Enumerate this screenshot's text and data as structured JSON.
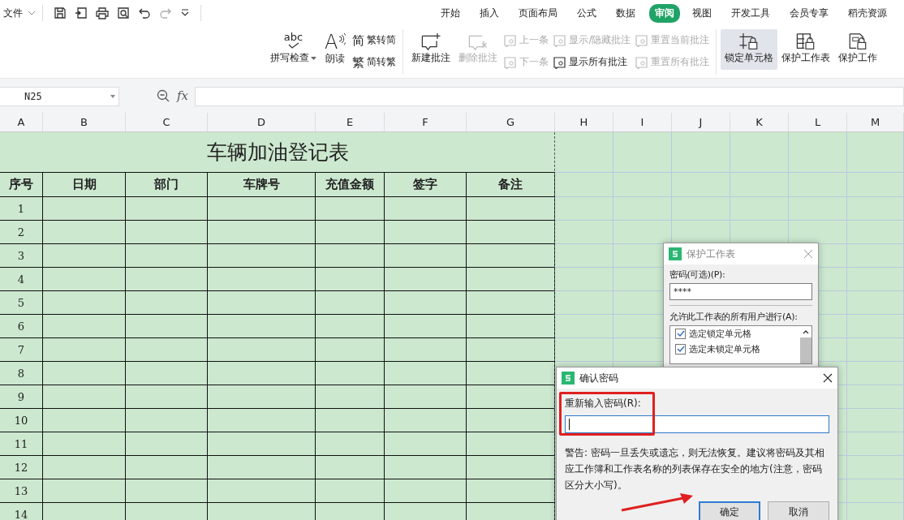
{
  "toolbar": {
    "file_menu": "文件"
  },
  "tabs": [
    {
      "label": "开始",
      "selected": false
    },
    {
      "label": "插入",
      "selected": false
    },
    {
      "label": "页面布局",
      "selected": false
    },
    {
      "label": "公式",
      "selected": false
    },
    {
      "label": "数据",
      "selected": false
    },
    {
      "label": "审阅",
      "selected": true
    },
    {
      "label": "视图",
      "selected": false
    },
    {
      "label": "开发工具",
      "selected": false
    },
    {
      "label": "会员专享",
      "selected": false
    },
    {
      "label": "稻壳资源",
      "selected": false
    }
  ],
  "ribbon": {
    "groups": [
      {
        "columns": [
          {
            "kind": "large",
            "items": [
              {
                "label": "拼写检查",
                "icon_text": "abc",
                "dropdown": true,
                "disabled": false,
                "selected": false
              }
            ]
          },
          {
            "kind": "large",
            "items": [
              {
                "label": "朗读",
                "icon_text": "A",
                "disabled": false,
                "selected": false
              }
            ]
          },
          {
            "kind": "small",
            "items": [
              {
                "label": "繁转简",
                "icon_text": "简",
                "disabled": false
              },
              {
                "label": "简转繁",
                "icon_text": "繁",
                "disabled": false
              }
            ]
          }
        ]
      },
      {
        "columns": [
          {
            "kind": "large",
            "items": [
              {
                "label": "新建批注",
                "disabled": false,
                "selected": false
              }
            ]
          },
          {
            "kind": "large",
            "items": [
              {
                "label": "删除批注",
                "disabled": true,
                "selected": false
              }
            ]
          },
          {
            "kind": "small",
            "items": [
              {
                "label": "上一条",
                "disabled": true
              },
              {
                "label": "下一条",
                "disabled": true
              }
            ]
          },
          {
            "kind": "small",
            "items": [
              {
                "label": "显示/隐藏批注",
                "disabled": true
              },
              {
                "label": "显示所有批注",
                "disabled": false
              }
            ]
          },
          {
            "kind": "small",
            "items": [
              {
                "label": "重置当前批注",
                "disabled": true
              },
              {
                "label": "重置所有批注",
                "disabled": true
              }
            ]
          }
        ]
      },
      {
        "columns": [
          {
            "kind": "large",
            "items": [
              {
                "label": "锁定单元格",
                "disabled": false,
                "selected": true
              }
            ]
          },
          {
            "kind": "large",
            "items": [
              {
                "label": "保护工作表",
                "disabled": false,
                "selected": false
              }
            ]
          },
          {
            "kind": "large",
            "items": [
              {
                "label": "保护工作",
                "disabled": false,
                "selected": false
              }
            ]
          }
        ]
      }
    ]
  },
  "formula_bar": {
    "name_box": "N25",
    "fx": "fx"
  },
  "sheet": {
    "columns": [
      "A",
      "B",
      "C",
      "D",
      "E",
      "F",
      "G",
      "H",
      "I",
      "J",
      "K",
      "L",
      "M"
    ],
    "title": "车辆加油登记表",
    "headers": [
      "序号",
      "日期",
      "部门",
      "车牌号",
      "充值金额",
      "签字",
      "备注"
    ],
    "rows": [
      "1",
      "2",
      "3",
      "4",
      "5",
      "6",
      "7",
      "8",
      "9",
      "10",
      "11",
      "12",
      "13",
      "14"
    ]
  },
  "protect_dialog": {
    "title": "保护工作表",
    "password_label": "密码(可选)(P):",
    "password": "****",
    "allow_label": "允许此工作表的所有用户进行(A):",
    "options": [
      {
        "label": "选定锁定单元格",
        "checked": true
      },
      {
        "label": "选定未锁定单元格",
        "checked": true
      }
    ]
  },
  "confirm_dialog": {
    "title": "确认密码",
    "label": "重新输入密码(R):",
    "warning": "警告: 密码一旦丢失或遗忘，则无法恢复。建议将密码及其相应工作簿和工作表名称的列表保存在安全的地方(注意，密码区分大小写)。",
    "buttons": [
      {
        "label": "确定",
        "default": true
      },
      {
        "label": "取消",
        "default": false
      }
    ]
  }
}
